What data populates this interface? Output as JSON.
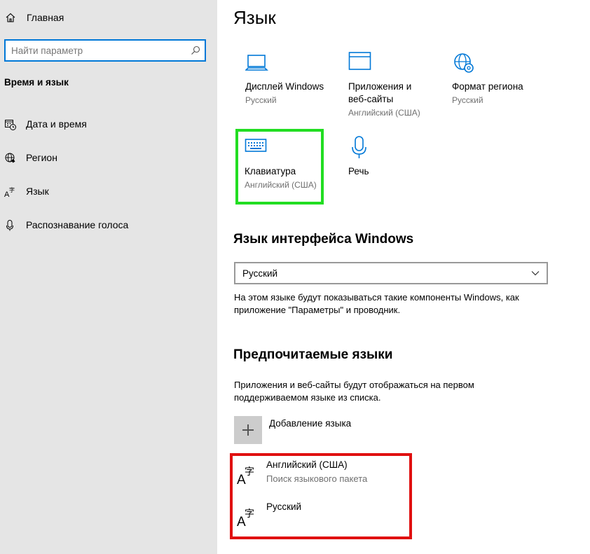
{
  "colors": {
    "accent": "#0078d7",
    "sidebar_bg": "#e5e5e5",
    "highlight_green": "#22dd22",
    "highlight_red": "#e01010"
  },
  "sidebar": {
    "home": {
      "label": "Главная",
      "icon": "home-icon"
    },
    "search": {
      "placeholder": "Найти параметр",
      "icon": "search-icon"
    },
    "section_title": "Время и язык",
    "items": [
      {
        "label": "Дата и время",
        "icon": "calendar-clock-icon"
      },
      {
        "label": "Регион",
        "icon": "globe-icon"
      },
      {
        "label": "Язык",
        "icon": "language-icon"
      },
      {
        "label": "Распознавание голоса",
        "icon": "microphone-icon"
      }
    ]
  },
  "main": {
    "title": "Язык",
    "tiles": [
      {
        "name": "Дисплей Windows",
        "sub": "Русский",
        "icon": "laptop-icon"
      },
      {
        "name": "Приложения и веб-сайты",
        "sub": "Английский (США)",
        "icon": "app-window-icon"
      },
      {
        "name": "Формат региона",
        "sub": "Русский",
        "icon": "globe-settings-icon"
      },
      {
        "name": "Клавиатура",
        "sub": "Английский (США)",
        "icon": "keyboard-icon"
      },
      {
        "name": "Речь",
        "sub": "",
        "icon": "microphone-icon"
      }
    ],
    "interface_language": {
      "heading": "Язык интерфейса Windows",
      "selected": "Русский",
      "description": "На этом языке будут показываться такие компоненты Windows, как приложение \"Параметры\" и проводник."
    },
    "preferred": {
      "heading": "Предпочитаемые языки",
      "description": "Приложения и веб-сайты будут отображаться на первом поддерживаемом языке из списка.",
      "add_label": "Добавление языка",
      "languages": [
        {
          "name": "Английский (США)",
          "status": "Поиск языкового пакета",
          "icon": "language-icon"
        },
        {
          "name": "Русский",
          "status": "",
          "icon": "language-icon"
        }
      ]
    }
  }
}
